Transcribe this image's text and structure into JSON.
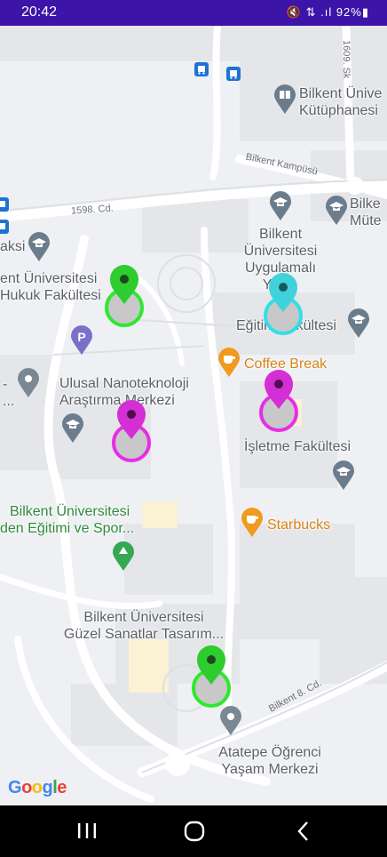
{
  "status_bar": {
    "time": "20:42",
    "icons_text": "🔇 ⇅ .ıl 92%▮",
    "battery": "92%"
  },
  "map": {
    "place_labels": [
      {
        "id": "library",
        "lines": [
          "Bilkent Ünive",
          "Kütüphanesi"
        ],
        "color": "gray"
      },
      {
        "id": "bilkent-mu",
        "lines": [
          "Bilke",
          "Müte"
        ],
        "color": "gray"
      },
      {
        "id": "bilkent-applied",
        "lines": [
          "Bilkent",
          "Üniversitesi",
          "Uygulamalı",
          "Yab..."
        ],
        "color": "gray"
      },
      {
        "id": "law",
        "lines": [
          "ent Üniversitesi",
          "Hukuk Fakültesi"
        ],
        "color": "gray"
      },
      {
        "id": "aksi",
        "lines": [
          "aksi"
        ],
        "color": "gray"
      },
      {
        "id": "education",
        "lines": [
          "Eğitim Fakültesi"
        ],
        "color": "gray"
      },
      {
        "id": "coffee-break",
        "lines": [
          "Coffee Break"
        ],
        "color": "orange"
      },
      {
        "id": "nanotech",
        "lines": [
          "Ulusal Nanoteknoloji",
          "Araştırma Merkezi"
        ],
        "color": "gray"
      },
      {
        "id": "dash",
        "lines": [
          "-",
          "..."
        ],
        "color": "gray"
      },
      {
        "id": "business",
        "lines": [
          "İşletme Fakültesi"
        ],
        "color": "gray"
      },
      {
        "id": "sports",
        "lines": [
          "Bilkent Üniversitesi",
          "den Eğitimi ve Spor..."
        ],
        "color": "green"
      },
      {
        "id": "starbucks",
        "lines": [
          "Starbucks"
        ],
        "color": "orange"
      },
      {
        "id": "fine-arts",
        "lines": [
          "Bilkent Üniversitesi",
          "Güzel Sanatlar Tasarım..."
        ],
        "color": "gray"
      },
      {
        "id": "atatepe",
        "lines": [
          "Atatepe Öğrenci",
          "Yaşam Merkezi"
        ],
        "color": "gray"
      }
    ],
    "road_labels": [
      {
        "id": "road-1609",
        "text": "1609. Sk"
      },
      {
        "id": "road-kampus",
        "text": "Bilkent Kampüsü"
      },
      {
        "id": "road-1598",
        "text": "1598. Cd."
      },
      {
        "id": "road-bilkent8",
        "text": "Bilkent 8. Cd."
      }
    ],
    "markers": [
      {
        "id": "marker-green-top",
        "color": "#2ee82e",
        "head": "#2ecc2e"
      },
      {
        "id": "marker-cyan",
        "color": "#2ee0e8",
        "head": "#3fd2dc"
      },
      {
        "id": "marker-magenta-right",
        "color": "#e62ee6",
        "head": "#d42fd4"
      },
      {
        "id": "marker-magenta-left",
        "color": "#e62ee6",
        "head": "#d42fd4"
      },
      {
        "id": "marker-green-bottom",
        "color": "#2ee82e",
        "head": "#2ecc2e"
      }
    ],
    "google_logo": {
      "letters": [
        "G",
        "o",
        "o",
        "g",
        "l",
        "e"
      ],
      "colors": [
        "#4285F4",
        "#EA4335",
        "#FBBC05",
        "#4285F4",
        "#34A853",
        "#EA4335"
      ]
    }
  },
  "nav_bar": {
    "recents": "recents-icon",
    "home": "home-icon",
    "back": "back-icon"
  }
}
